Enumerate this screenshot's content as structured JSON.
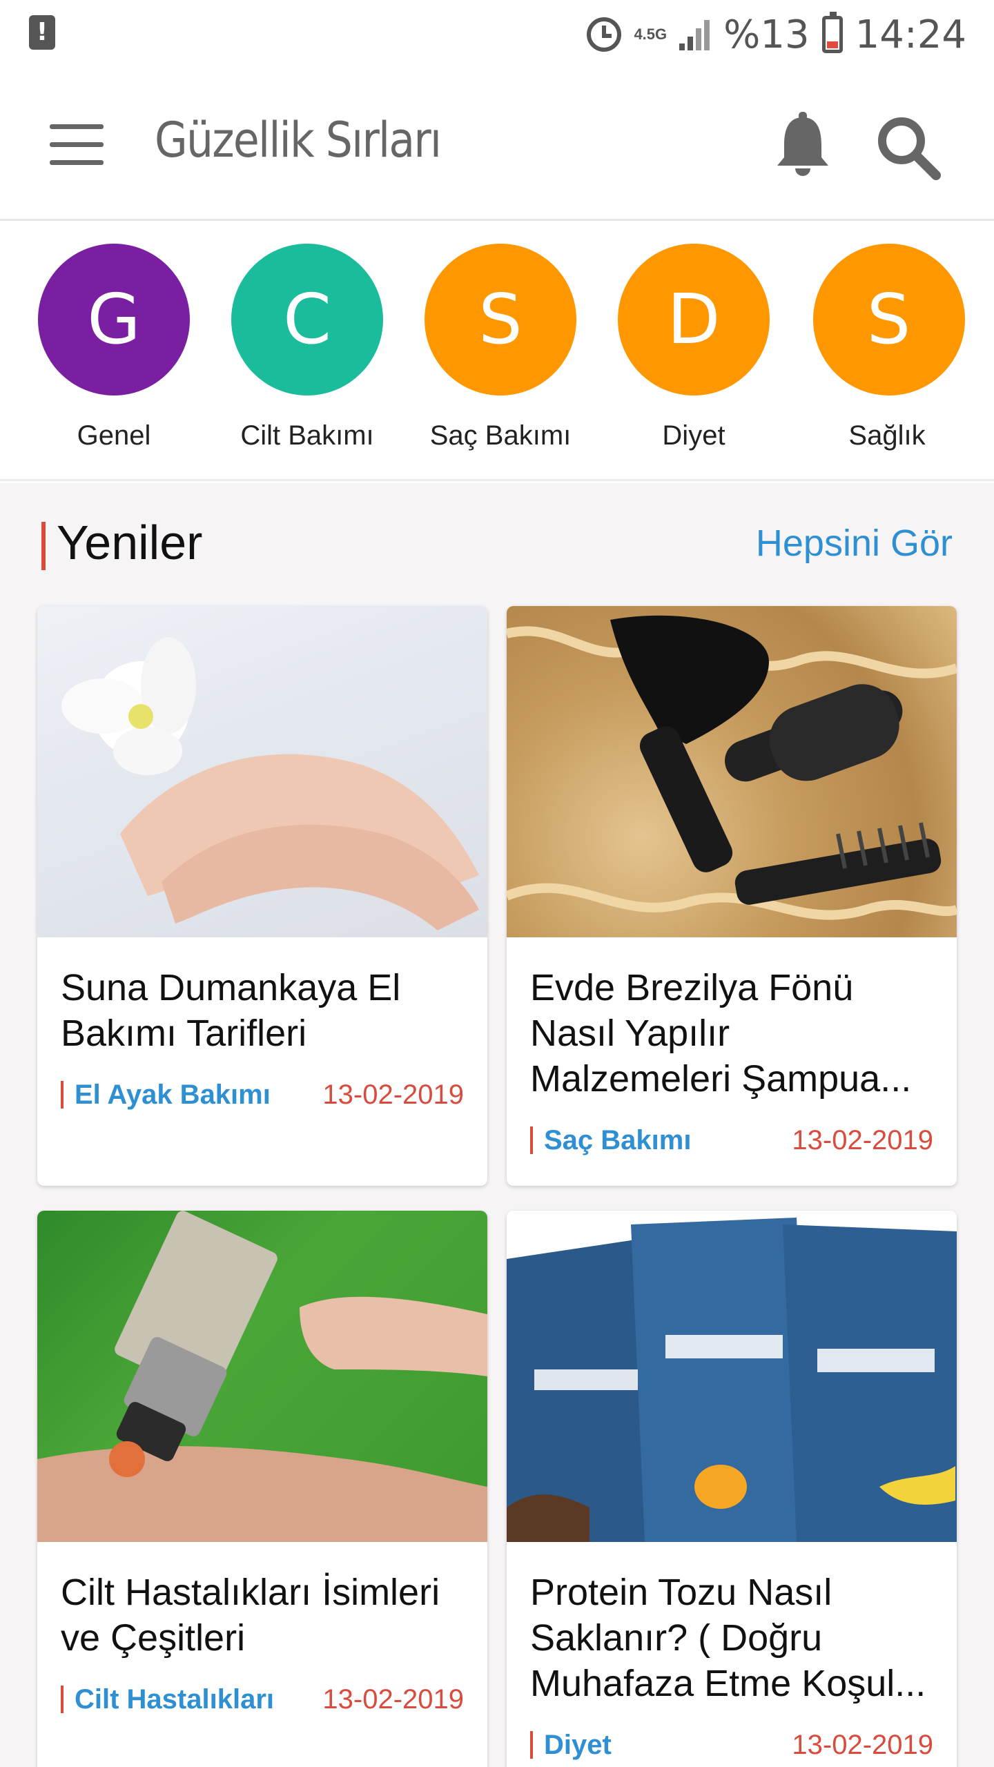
{
  "status_bar": {
    "network": "4.5G",
    "battery_percent": "%13",
    "time": "14:24",
    "icons": [
      "alert-icon",
      "alarm-icon",
      "signal-icon",
      "battery-icon"
    ]
  },
  "app_bar": {
    "title": "Güzellik Sırları",
    "icons": [
      "menu-icon",
      "bell-icon",
      "search-icon"
    ]
  },
  "categories": [
    {
      "letter": "G",
      "label": "Genel",
      "color": "#7b1fa2"
    },
    {
      "letter": "C",
      "label": "Cilt Bakımı",
      "color": "#1abc9c"
    },
    {
      "letter": "S",
      "label": "Saç Bakımı",
      "color": "#ff9800"
    },
    {
      "letter": "D",
      "label": "Diyet",
      "color": "#ff9800"
    },
    {
      "letter": "S",
      "label": "Sağlık",
      "color": "#ff9800"
    }
  ],
  "section": {
    "title": "Yeniler",
    "see_all": "Hepsini Gör"
  },
  "articles": [
    {
      "title": "Suna Dumankaya El Bakımı Tarifleri",
      "category": "El Ayak Bakımı",
      "date": "13-02-2019",
      "image": "hands-orchid-image"
    },
    {
      "title": "Evde Brezilya Fönü Nasıl Yapılır Malzemeleri Şampua...",
      "category": "Saç Bakımı",
      "date": "13-02-2019",
      "image": "hair-dryer-brushes-image"
    },
    {
      "title": "Cilt Hastalıkları İsimleri ve Çeşitleri",
      "category": "Cilt Hastalıkları",
      "date": "13-02-2019",
      "image": "skin-laser-treatment-image"
    },
    {
      "title": "Protein Tozu Nasıl Saklanır? ( Doğru Muhafaza Etme Koşul...",
      "category": "Diyet",
      "date": "13-02-2019",
      "image": "protein-powder-packs-image"
    }
  ],
  "colors": {
    "accent_blue": "#2f8fd3",
    "accent_red": "#d94b3d",
    "feed_background": "#f7f4f5"
  }
}
